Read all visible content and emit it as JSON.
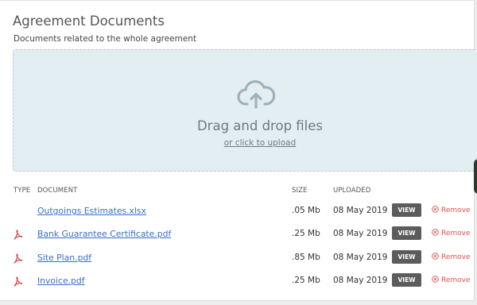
{
  "section": {
    "title": "Agreement Documents",
    "subtitle": "Documents related to the whole agreement"
  },
  "dropzone": {
    "icon": "cloud-upload-icon",
    "text": "Drag and drop files",
    "link": "or click to upload"
  },
  "table": {
    "headers": {
      "type": "TYPE",
      "document": "DOCUMENT",
      "size": "SIZE",
      "uploaded": "UPLOADED"
    },
    "rows": [
      {
        "type_icon": "",
        "name": "Outgoings Estimates.xlsx",
        "size": ".05 Mb",
        "uploaded": "08 May 2019",
        "view": "VIEW",
        "remove": "Remove"
      },
      {
        "type_icon": "pdf-icon",
        "name": "Bank Guarantee Certificate.pdf",
        "size": ".25 Mb",
        "uploaded": "08 May 2019",
        "view": "VIEW",
        "remove": "Remove"
      },
      {
        "type_icon": "pdf-icon",
        "name": "Site Plan.pdf",
        "size": ".85 Mb",
        "uploaded": "08 May 2019",
        "view": "VIEW",
        "remove": "Remove"
      },
      {
        "type_icon": "pdf-icon",
        "name": "Invoice.pdf",
        "size": ".25 Mb",
        "uploaded": "08 May 2019",
        "view": "VIEW",
        "remove": "Remove"
      }
    ]
  },
  "colors": {
    "link": "#3a6fc4",
    "dropzone_bg": "#e3eef2",
    "view_button": "#5c5c5c",
    "remove": "#e05050",
    "pdf_icon": "#d03a3a"
  }
}
